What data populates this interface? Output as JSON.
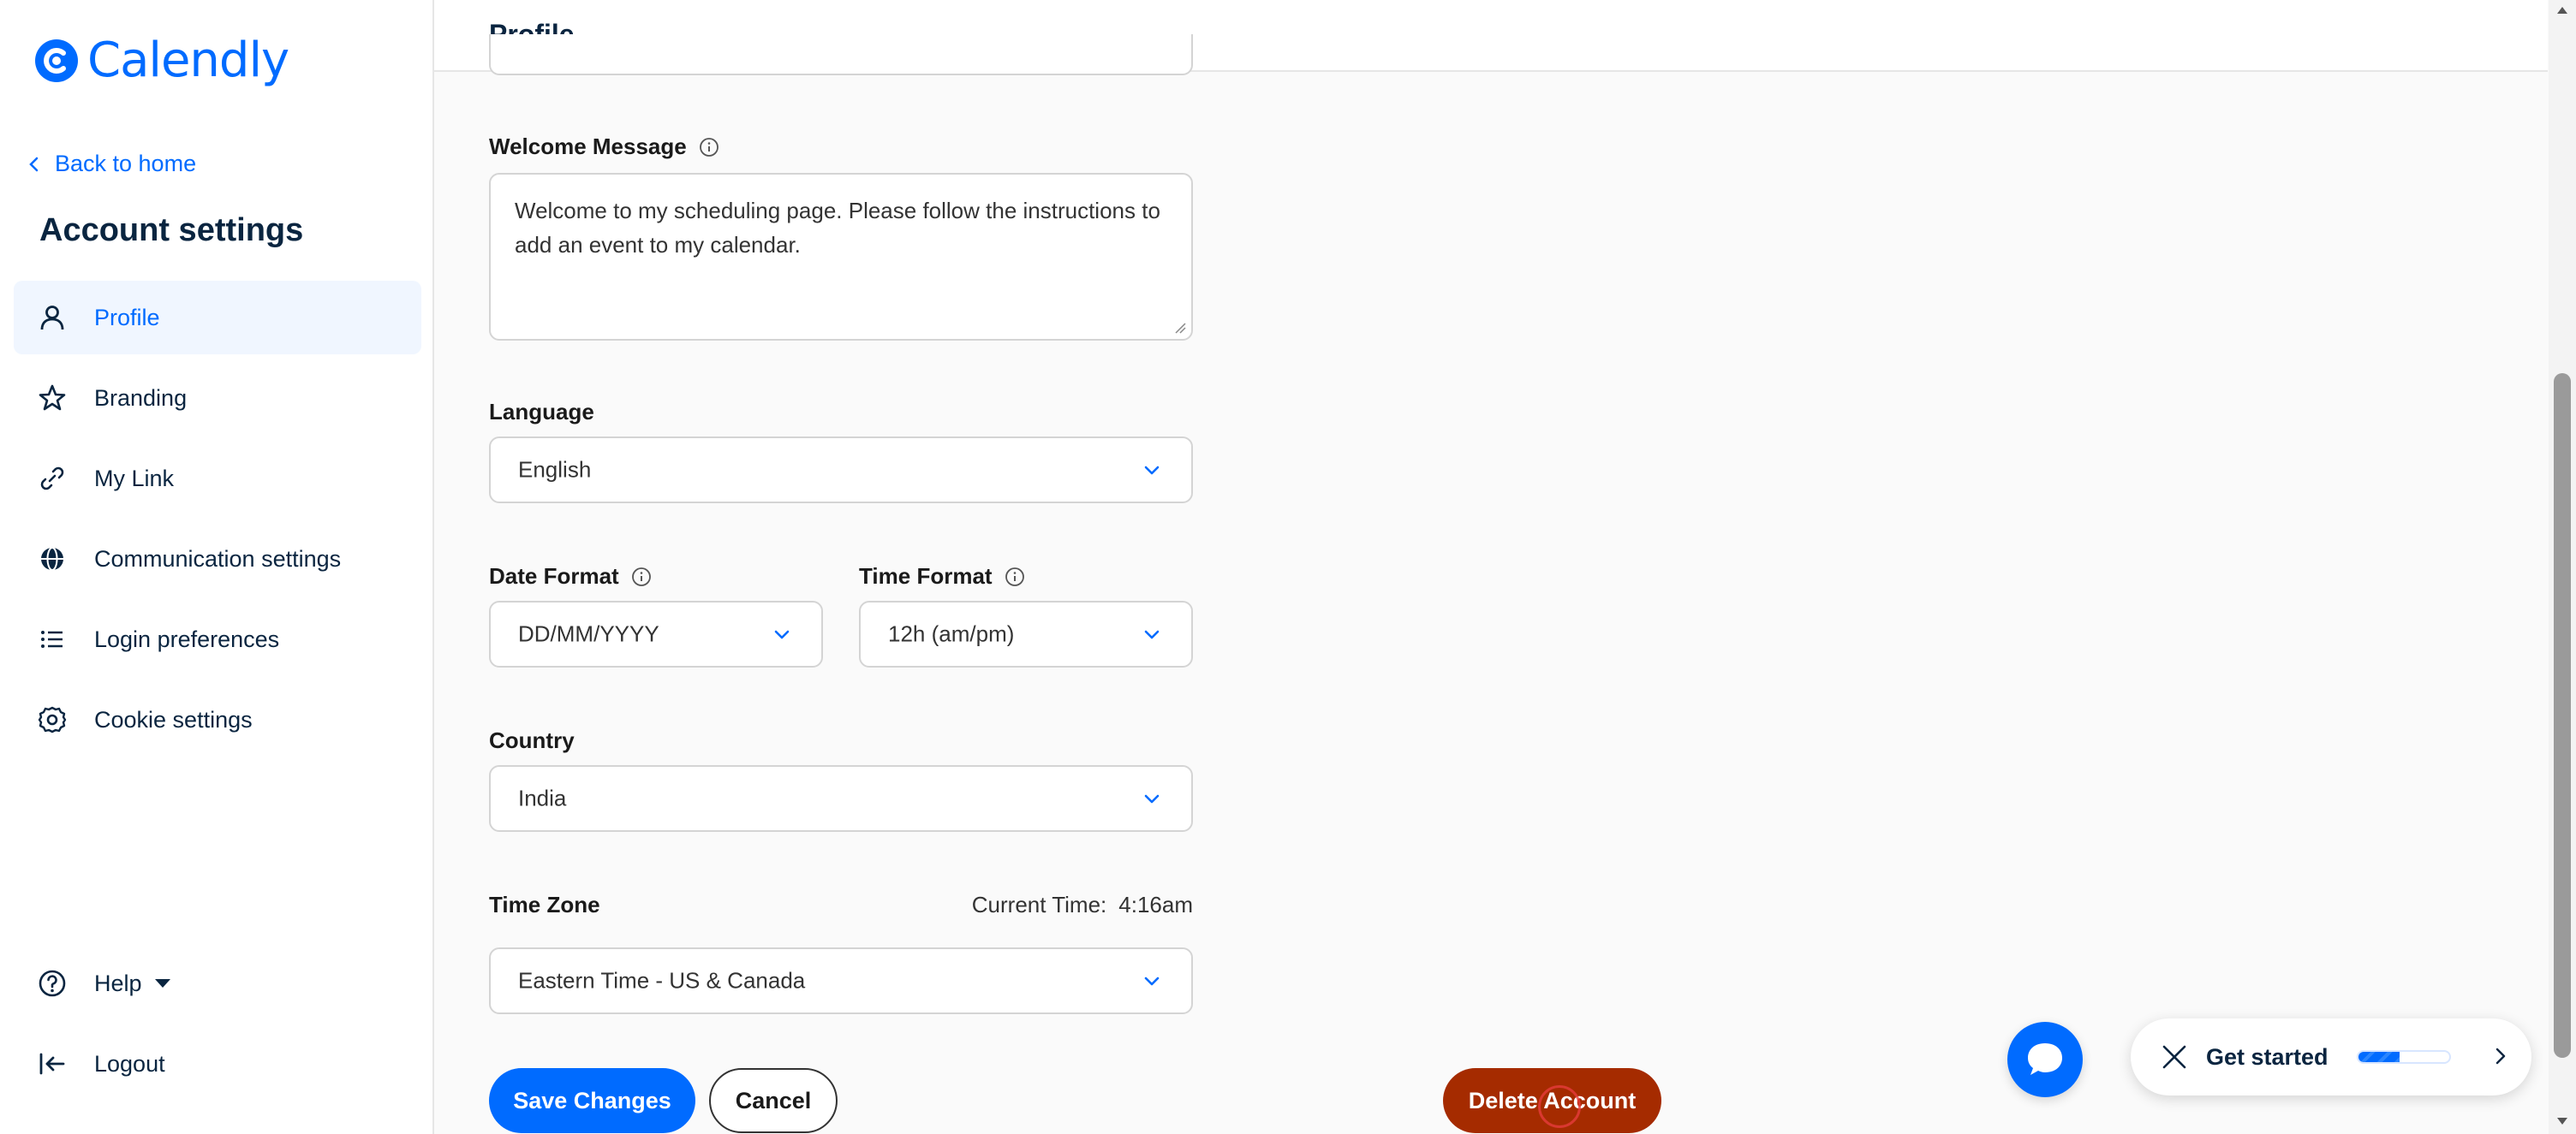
{
  "app": {
    "logo_text": "Calendly"
  },
  "sidebar": {
    "back_label": "Back to home",
    "section_title": "Account settings",
    "items": [
      {
        "label": "Profile",
        "icon": "user-icon",
        "active": true
      },
      {
        "label": "Branding",
        "icon": "star-icon",
        "active": false
      },
      {
        "label": "My Link",
        "icon": "link-icon",
        "active": false
      },
      {
        "label": "Communication settings",
        "icon": "globe-icon",
        "active": false
      },
      {
        "label": "Login preferences",
        "icon": "list-icon",
        "active": false
      },
      {
        "label": "Cookie settings",
        "icon": "gear-icon",
        "active": false
      }
    ],
    "help_label": "Help",
    "logout_label": "Logout"
  },
  "header": {
    "title": "Profile"
  },
  "form": {
    "welcome": {
      "label": "Welcome Message",
      "value": "Welcome to my scheduling page. Please follow the instructions to add an event to my calendar."
    },
    "language": {
      "label": "Language",
      "value": "English"
    },
    "date_format": {
      "label": "Date Format",
      "value": "DD/MM/YYYY"
    },
    "time_format": {
      "label": "Time Format",
      "value": "12h (am/pm)"
    },
    "country": {
      "label": "Country",
      "value": "India"
    },
    "time_zone": {
      "label": "Time Zone",
      "current_time_label": "Current Time:",
      "current_time": "4:16am",
      "value": "Eastern Time - US & Canada"
    }
  },
  "actions": {
    "save_label": "Save Changes",
    "cancel_label": "Cancel",
    "delete_label": "Delete Account"
  },
  "widget": {
    "get_started_label": "Get started",
    "progress": 0.45
  },
  "colors": {
    "accent": "#006bff",
    "danger": "#a52b00",
    "active_bg": "#f0f6ff"
  }
}
